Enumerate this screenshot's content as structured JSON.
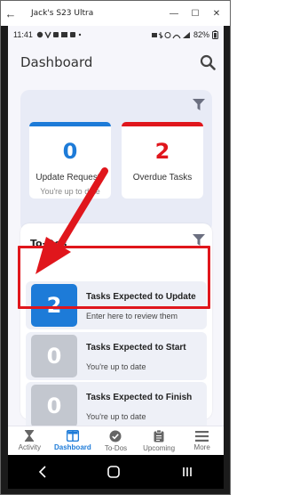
{
  "window": {
    "title": "Jack's S23 Ultra",
    "back": "←",
    "minimize": "—",
    "maximize": "☐",
    "close": "✕"
  },
  "status": {
    "time": "11:41",
    "battery": "82%"
  },
  "header": {
    "title": "Dashboard"
  },
  "summary": {
    "cards": [
      {
        "number": "0",
        "label": "Update Requests",
        "sub": "You're up to date",
        "accent": "#1d7bd8",
        "number_color": "#1d7bd8"
      },
      {
        "number": "2",
        "label": "Overdue Tasks",
        "sub": "",
        "accent": "#e0161c",
        "number_color": "#e0161c"
      }
    ]
  },
  "todos": {
    "title": "To-Dos",
    "items": [
      {
        "count": "2",
        "title": "Tasks Expected to Update",
        "sub": "Enter here to review them",
        "badge_color": "#1d7bd8"
      },
      {
        "count": "0",
        "title": "Tasks Expected to Start",
        "sub": "You're up to date",
        "badge_color": "#c3c7cf"
      },
      {
        "count": "0",
        "title": "Tasks Expected to Finish",
        "sub": "You're up to date",
        "badge_color": "#c3c7cf"
      }
    ]
  },
  "nav": {
    "items": [
      {
        "label": "Activity",
        "icon": "hourglass-icon"
      },
      {
        "label": "Dashboard",
        "icon": "dashboard-icon",
        "active": true
      },
      {
        "label": "To-Dos",
        "icon": "check-circle-icon"
      },
      {
        "label": "Upcoming",
        "icon": "clipboard-icon"
      },
      {
        "label": "More",
        "icon": "menu-icon"
      }
    ]
  },
  "colors": {
    "accent": "#1d7bd8",
    "alert": "#e0161c"
  }
}
